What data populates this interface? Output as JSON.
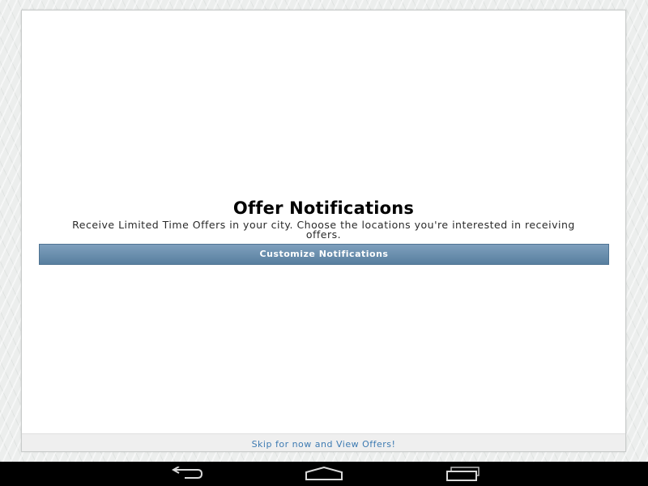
{
  "dialog": {
    "title": "Offer Notifications",
    "description": "Receive Limited Time Offers in your city. Choose the locations you're interested in receiving offers.",
    "customize_label": "Customize Notifications",
    "skip_label": "Skip for now and View Offers!"
  },
  "navbar": {
    "back_icon": "back-icon",
    "home_icon": "home-icon",
    "recents_icon": "recent-apps-icon"
  },
  "colors": {
    "button": "#6a8eaf",
    "link": "#3e7bb2",
    "navbar": "#000000"
  }
}
